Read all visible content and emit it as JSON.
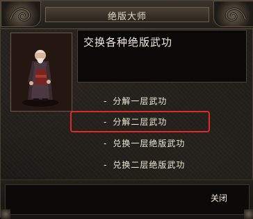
{
  "window": {
    "title": "绝版大师"
  },
  "npc": {
    "portrait_icon": "npc-elder-portrait"
  },
  "dialog": {
    "text": "交换各种绝版武功"
  },
  "options": [
    {
      "dash": "-",
      "label": "分解一层武功"
    },
    {
      "dash": "-",
      "label": "分解二层武功",
      "highlighted": true
    },
    {
      "dash": "-",
      "label": "兑换一层绝版武功"
    },
    {
      "dash": "-",
      "label": "兑换二层绝版武功"
    }
  ],
  "footer": {
    "close_label": "关闭"
  },
  "colors": {
    "text": "#f0ead8",
    "highlight_border": "#e02a2a",
    "frame": "#4a4034"
  }
}
